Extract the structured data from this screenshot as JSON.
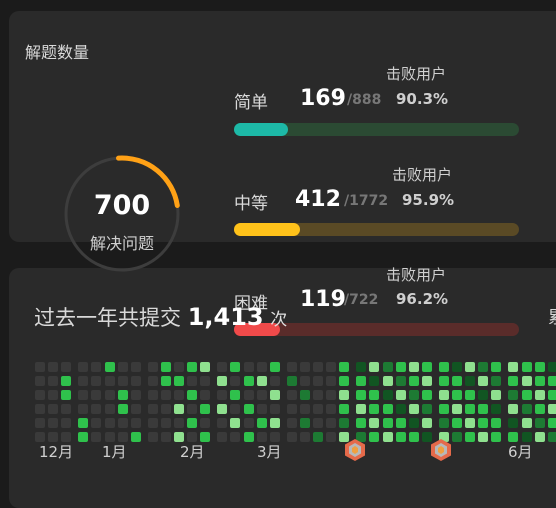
{
  "summary": {
    "title": "解题数量",
    "solved": "700",
    "solved_label": "解决问题"
  },
  "difficulties": [
    {
      "name": "简单",
      "solved": "169",
      "total": "/888",
      "beat_label": "击败用户",
      "beat_pct": "90.3%",
      "fill": 0.19,
      "color": "#1db9a7",
      "track": "#2b4a33"
    },
    {
      "name": "中等",
      "solved": "412",
      "total": "/1772",
      "beat_label": "击败用户",
      "beat_pct": "95.9%",
      "fill": 0.23,
      "color": "#ffc21a",
      "track": "#5a4a25"
    },
    {
      "name": "困难",
      "solved": "119",
      "total": "/722",
      "beat_label": "击败用户",
      "beat_pct": "96.2%",
      "fill": 0.16,
      "color": "#f04a4a",
      "track": "#5a2c2a"
    }
  ],
  "heatmap": {
    "title_prefix": "过去一年共提交",
    "count": "1,413",
    "unit": "次",
    "right_cut": "累",
    "months": [
      "12月",
      "1月",
      "2月",
      "3月",
      "6月"
    ],
    "colors": {
      "empty": "#3a3a3a",
      "l1": "#1d7a33",
      "l2": "#2fc14c",
      "l3": "#8fe08f",
      "dark": "#115522"
    }
  }
}
